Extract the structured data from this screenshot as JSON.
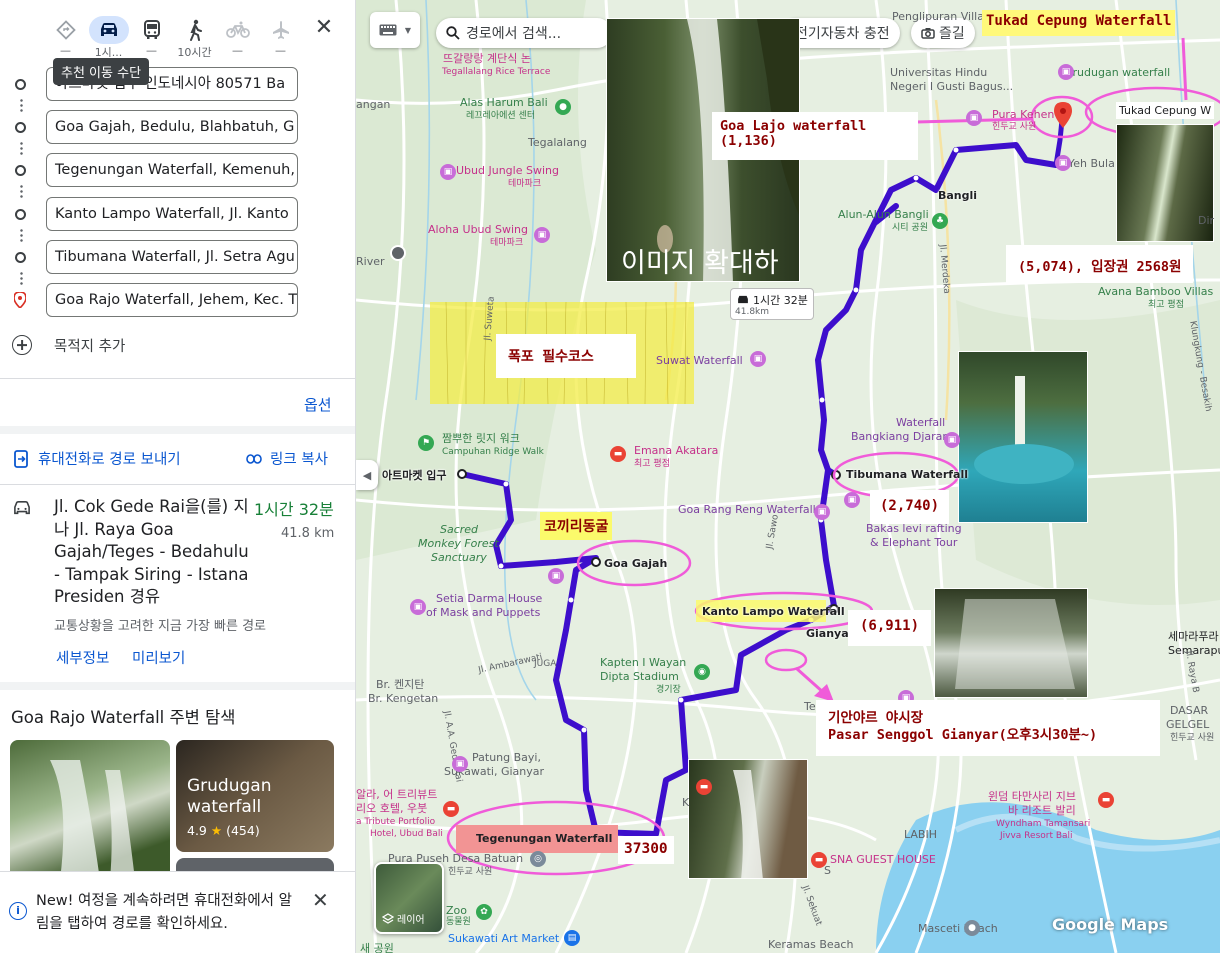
{
  "panel": {
    "modes": [
      {
        "name": "best",
        "icon": "diamond-route-icon",
        "time": "—"
      },
      {
        "name": "car",
        "icon": "car-icon",
        "time": "1시..."
      },
      {
        "name": "transit",
        "icon": "bus-icon",
        "time": "—"
      },
      {
        "name": "walk",
        "icon": "walk-icon",
        "time": "10시간"
      },
      {
        "name": "bike",
        "icon": "bike-icon",
        "time": "—"
      },
      {
        "name": "flight",
        "icon": "plane-icon",
        "time": "—"
      }
    ],
    "tooltip": "추천 이동 수단",
    "stops": [
      "아트마켓 입구 인도네시아 80571 Ba",
      "Goa Gajah, Bedulu, Blahbatuh, G",
      "Tegenungan Waterfall, Kemenuh,",
      "Kanto Lampo Waterfall, Jl. Kanto",
      "Tibumana Waterfall, Jl. Setra Agu",
      "Goa Rajo Waterfall, Jehem, Kec. T"
    ],
    "add_destination": "목적지 추가",
    "options": "옵션",
    "send_to_phone": "휴대전화로 경로 보내기",
    "copy_link": "링크 복사",
    "route": {
      "description": "Jl. Cok Gede Rai을(를) 지나 Jl. Raya Goa Gajah/Teges - Bedahulu - Tampak Siring - Istana Presiden 경유",
      "duration": "1시간 32분",
      "distance": "41.8 km",
      "subtitle": "교통상황을 고려한 지금 가장 빠른 경로",
      "details": "세부정보",
      "preview": "미리보기"
    },
    "nearby_title": "Goa Rajo Waterfall 주변 탐색",
    "nearby_card": {
      "name": "Grudugan waterfall",
      "rating": "4.9",
      "reviews": "(454)"
    },
    "banner": "New! 여정을 계속하려면 휴대전화에서 알림을 탭하여 경로를 확인하세요."
  },
  "map": {
    "search_placeholder": "경로에서 검색...",
    "chip_ev": "전기자동차 충전",
    "chip_attractions": "즐길",
    "layers": "레이어",
    "trip_time": "1시간 32분",
    "trip_dist": "41.8km",
    "photo_overlay": "이미지 확대하",
    "waypoints": {
      "start": "아트마켓 입구",
      "goa_gajah": "Goa Gajah",
      "tegenungan": "Tegenungan Waterfall",
      "kanto": "Kanto Lampo Waterfall",
      "tibumana": "Tibumana Waterfall",
      "bangli": "Bangli",
      "gianyar": "Gianyar"
    },
    "labels": {
      "penglipuran": "Penglipuran Village",
      "ddragalang": "뜨갈랑랑 계단식 논",
      "tegallalang_rice": "Tegallalang Rice Terrace",
      "universitas": "Universitas Hindu",
      "negeri": "Negeri I Gusti Bagus...",
      "grudugan": "Grudugan waterfall",
      "alas_harum": "Alas Harum Bali",
      "alas_harum_ko": "레끄레아에션 센터",
      "angan": "angan",
      "pura_kehen": "Pura Kehen",
      "pura_kehen_ko": "힌두교 사원",
      "yeh_bulan": "Yeh Bula",
      "tegalalang": "Tegalalang",
      "ubud_jungle": "Ubud Jungle Swing",
      "ubud_jungle_ko": "테마파크",
      "alun": "Alun-Alun Bangli",
      "alun_ko": "시티 공원",
      "aloha": "Aloha Ubud Swing",
      "aloha_ko": "테마파크",
      "river": "River",
      "avana": "Avana Bamboo Villas",
      "avana_ko": "최고 평점",
      "suwat": "Suwat Waterfall",
      "bangkiang": "Waterfall",
      "bangkiang2": "Bangkiang Djaran",
      "campuhan": "짬뿌한 릿지 워크",
      "campuhan_en": "Campuhan Ridge Walk",
      "emana": "Emana Akatara",
      "emana_ko": "최고 평점",
      "goa_rang": "Goa Rang Reng Waterfall",
      "bakas": "Bakas levi rafting",
      "bakas2": "& Elephant Tour",
      "monkey": "Sacred",
      "monkey2": "Monkey Forest",
      "monkey3": "Sanctuary",
      "setia": "Setia Darma House",
      "setia2": "of Mask and Puppets",
      "kapten": "Kapten I Wayan",
      "kapten2": "Dipta Stadium",
      "kapten_ko": "경기장",
      "kengetan": "Br. 켄지탄",
      "kengetan2": "Br. Kengetan",
      "patung": "Patung Bayi,",
      "patung2": "Sukawati, Gianyar",
      "alila": "알라, 어 트리뷰트",
      "alila2": "리오 호텔, 우붓",
      "alila3": "a Tribute Portfolio",
      "alila4": "Hotel, Ubud Bali",
      "pura_puseh": "Pura Puseh Desa Batuan",
      "pura_puseh_ko": "힌두교 사원",
      "zoo": "Zoo",
      "zoo_ko": "동물원",
      "sukawati": "Sukawati Art Market",
      "new_park": "새 공원",
      "wyndham": "윈덤 타만사리 지브",
      "wyndham2": "바 리조트 발리",
      "wyndham3": "Wyndham Tamansari",
      "wyndham4": "Jivva Resort Bali",
      "sna": "SNA GUEST HOUSE",
      "labih": "LABIH",
      "masceti": "Masceti Beach",
      "keramas": "Keramas Beach",
      "semarapura": "세마라푸라",
      "semarapura2": "Semarapu",
      "dasar": "DASAR",
      "gelgel": "GELGEL",
      "gelgel_ko": "힌두교 사원",
      "juga": "JUGA",
      "klungkung": "Klungkung - Besakih",
      "jl_raya": "Jl. Raya B",
      "jl_merdeka": "Jl. Merdeka",
      "jl_suweta": "Jl. Suweta",
      "jl_ambarawati": "Jl. Ambarawati",
      "jl_gede_rai": "Jl. A.A. Gede Rai",
      "jl_sawo": "Jl. Sawo",
      "jl_sekuat": "Jl. Sekuat",
      "tel": "Tel",
      "k": "K",
      "s": "S",
      "d": "Dir"
    },
    "annotations": {
      "tukad_title": "Tukad Cepung Waterfall",
      "tukad_map": "Tukad Cepung W",
      "goa_lajo": "Goa Lajo waterfall",
      "goa_lajo_price": "(1,136)",
      "tukad_price": "(5,074), 입장권 2568원",
      "must": "폭포 필수코스",
      "tibumana_price": "(2,740)",
      "elephant_cave": "코끼리동굴",
      "kanto_price": "(6,911)",
      "night_market": "기안야르 야시장",
      "night_market2": "Pasar Senggol Gianyar(오후3시30분~)",
      "tegenungan_price": "37300"
    },
    "brand": "Google Maps",
    "colors": {
      "route": "#3d0ecc",
      "highlight_pink": "#f05bd9",
      "yellow_box": "#fbfa6b",
      "dark_red_text": "#8b0000"
    }
  }
}
